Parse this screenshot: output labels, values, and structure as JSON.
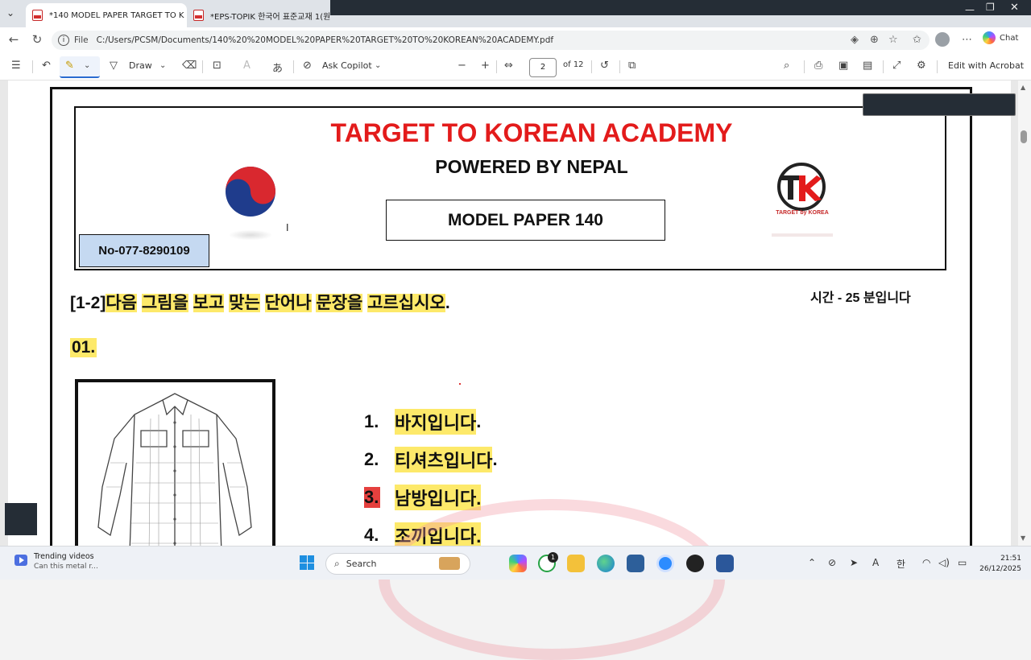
{
  "browser": {
    "tabs": [
      {
        "label": "*140 MODEL PAPER TARGET TO K",
        "active": true
      },
      {
        "label": "*EPS-TOPIK 한국어 표준교재 1(원",
        "active": false
      }
    ],
    "address": {
      "scheme_label": "File",
      "url": "C:/Users/PCSM/Documents/140%20%20MODEL%20PAPER%20TARGET%20TO%20KOREAN%20ACADEMY.pdf"
    },
    "chat_label": "Chat"
  },
  "pdf_toolbar": {
    "draw_label": "Draw",
    "ask_copilot_label": "Ask Copilot",
    "page_current": "2",
    "page_total": "of 12",
    "edit_acrobat_label": "Edit with Acrobat"
  },
  "document": {
    "academy_title": "TARGET TO KOREAN ACADEMY",
    "powered_by": "POWERED BY NEPAL",
    "model_paper": "MODEL PAPER 140",
    "phone": "No-077-8290109",
    "logo_caption": "TARGET by KOREA",
    "instruction_prefix": "[1-2]",
    "instruction_words": [
      "다음",
      "그림을",
      "보고",
      "맞는",
      "단어나",
      "문장을",
      "고르십시오"
    ],
    "instruction_end": ".",
    "time_note": "시간 - 25 분입니다",
    "question_number": "01.",
    "options": [
      {
        "num": "1.",
        "text": "바지입니다",
        "end": ".",
        "marked": false
      },
      {
        "num": "2.",
        "text": "티셔츠입니다",
        "end": ".",
        "marked": false
      },
      {
        "num": "3.",
        "text": "남방입니다.",
        "end": "",
        "marked": true
      },
      {
        "num": "4.",
        "text": "조끼입니다.",
        "end": "",
        "marked": false
      }
    ]
  },
  "taskbar": {
    "widget_title": "Trending videos",
    "widget_sub": "Can this metal r...",
    "search_placeholder": "Search",
    "badge_count": "1",
    "ime_label": "한",
    "time": "21:51",
    "date": "26/12/2025"
  },
  "colors": {
    "title_red": "#e31b1b",
    "highlight_yellow": "#fde96a",
    "answer_mark_red": "#e5403e",
    "phone_box_blue": "#c5d9f1"
  }
}
